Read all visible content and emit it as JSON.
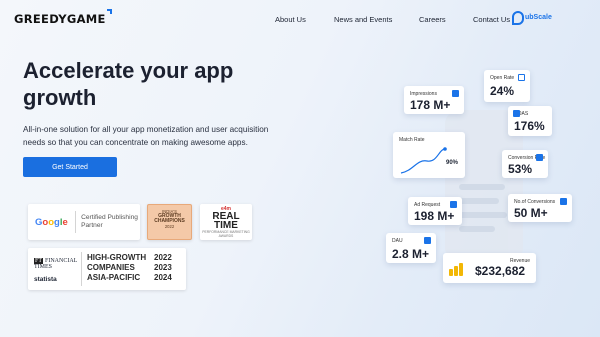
{
  "nav": {
    "logo": "GREEDYGAME",
    "links": [
      "About Us",
      "News and Events",
      "Careers",
      "Contact Us"
    ],
    "partner_logo": "ubScale"
  },
  "hero": {
    "title": "Accelerate your app growth",
    "subtitle": "All-in-one solution for all your app monetization and user acquisition needs so that you can concentrate on making awesome apps.",
    "cta": "Get Started"
  },
  "badges": {
    "google": {
      "brand": "Google",
      "text": "Certified Publishing Partner"
    },
    "growth": {
      "line1": "INDIA'S",
      "line2": "GROWTH",
      "line3": "CHAMPIONS",
      "year": "2022"
    },
    "realtime": {
      "top": "e4m",
      "title": "REAL TIME",
      "bottom": "PERFORMANCE MARKETING AWARDS"
    },
    "ft": {
      "ft_line1": "FINANCIAL",
      "ft_line2": "TIMES",
      "statista": "statista",
      "title": "HIGH-GROWTH COMPANIES ASIA-PACIFIC",
      "years": [
        "2022",
        "2023",
        "2024"
      ]
    }
  },
  "metrics": {
    "impressions": {
      "label": "Impressions",
      "value": "178 M+"
    },
    "open_rate": {
      "label": "Open Rate",
      "value": "24%"
    },
    "roas": {
      "label": "ROAS",
      "value": "176%"
    },
    "match_rate": {
      "label": "Match Rate",
      "value": "90%"
    },
    "conversion_rate": {
      "label": "Conversion Rate",
      "value": "53%"
    },
    "ad_request": {
      "label": "Ad Request",
      "value": "198 M+"
    },
    "no_of_conversions": {
      "label": "No.of Conversions",
      "value": "50 M+"
    },
    "dau": {
      "label": "DAU",
      "value": "2.8 M+"
    },
    "revenue": {
      "label": "Revenue",
      "value": "$232,682"
    }
  },
  "colors": {
    "accent": "#1a6fe0",
    "coin": "#f2b705"
  }
}
